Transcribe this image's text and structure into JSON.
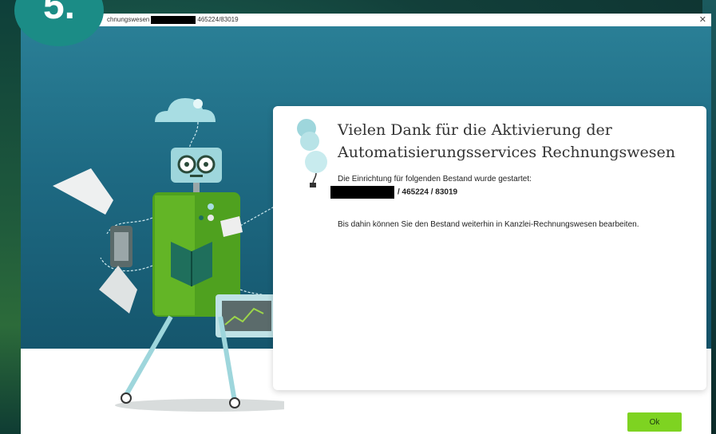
{
  "window": {
    "title_prefix": "chnungswesen",
    "title_suffix": "465224/83019",
    "close_glyph": "✕"
  },
  "step": {
    "number": "5."
  },
  "card": {
    "title": "Vielen Dank für die Aktivierung der Automatisierungsservices Rechnungswesen",
    "line1": "Die Einrichtung für folgenden Bestand wurde gestartet:",
    "line2": "/ 465224 / 83019",
    "line3": "Bis dahin können Sie den Bestand weiterhin in Kanzlei-Rechnungswesen bearbeiten."
  },
  "footer": {
    "ok_label": "Ok"
  },
  "colors": {
    "accent": "#7ed321",
    "scene": "#1e6a83",
    "step_circle": "#1b8c86"
  },
  "icons": [
    "close-icon",
    "balloon-icon",
    "robot-illustration"
  ]
}
